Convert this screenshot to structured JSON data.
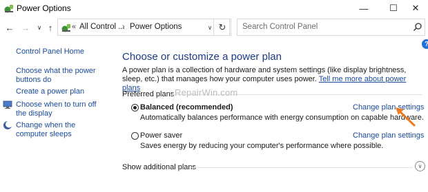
{
  "window": {
    "title": "Power Options",
    "minimize_glyph": "—",
    "maximize_glyph": "☐",
    "close_glyph": "✕"
  },
  "nav": {
    "back_glyph": "←",
    "forward_glyph": "→",
    "recent_glyph": "∨",
    "up_glyph": "↑",
    "refresh_glyph": "↻",
    "address_chevron": "«",
    "crumbs": [
      "All Control ...",
      "Power Options"
    ],
    "crumb_separator": "›",
    "dropdown_glyph": "∨"
  },
  "search": {
    "placeholder": "Search Control Panel"
  },
  "left_pane": {
    "home": "Control Panel Home",
    "links": [
      "Choose what the power buttons do",
      "Create a power plan",
      "Choose when to turn off the display",
      "Change when the computer sleeps"
    ]
  },
  "main": {
    "heading": "Choose or customize a power plan",
    "description": "A power plan is a collection of hardware and system settings (like display brightness, sleep, etc.) that manages how your computer uses power.",
    "tell_me_more": "Tell me more about power plans",
    "preferred_label": "Preferred plans",
    "watermark": "RepairWin.com",
    "plans": [
      {
        "name": "Balanced (recommended)",
        "description": "Automatically balances performance with energy consumption on capable hardware.",
        "link": "Change plan settings",
        "selected": true
      },
      {
        "name": "Power saver",
        "description": "Saves energy by reducing your computer's performance where possible.",
        "link": "Change plan settings",
        "selected": false
      }
    ],
    "show_additional": "Show additional plans",
    "show_chevron": "∨"
  },
  "help_glyph": "?",
  "colors": {
    "link": "#1a4a9c",
    "heading": "#1b3a8a",
    "arrow": "#f07a22",
    "help": "#1e6fd9"
  }
}
